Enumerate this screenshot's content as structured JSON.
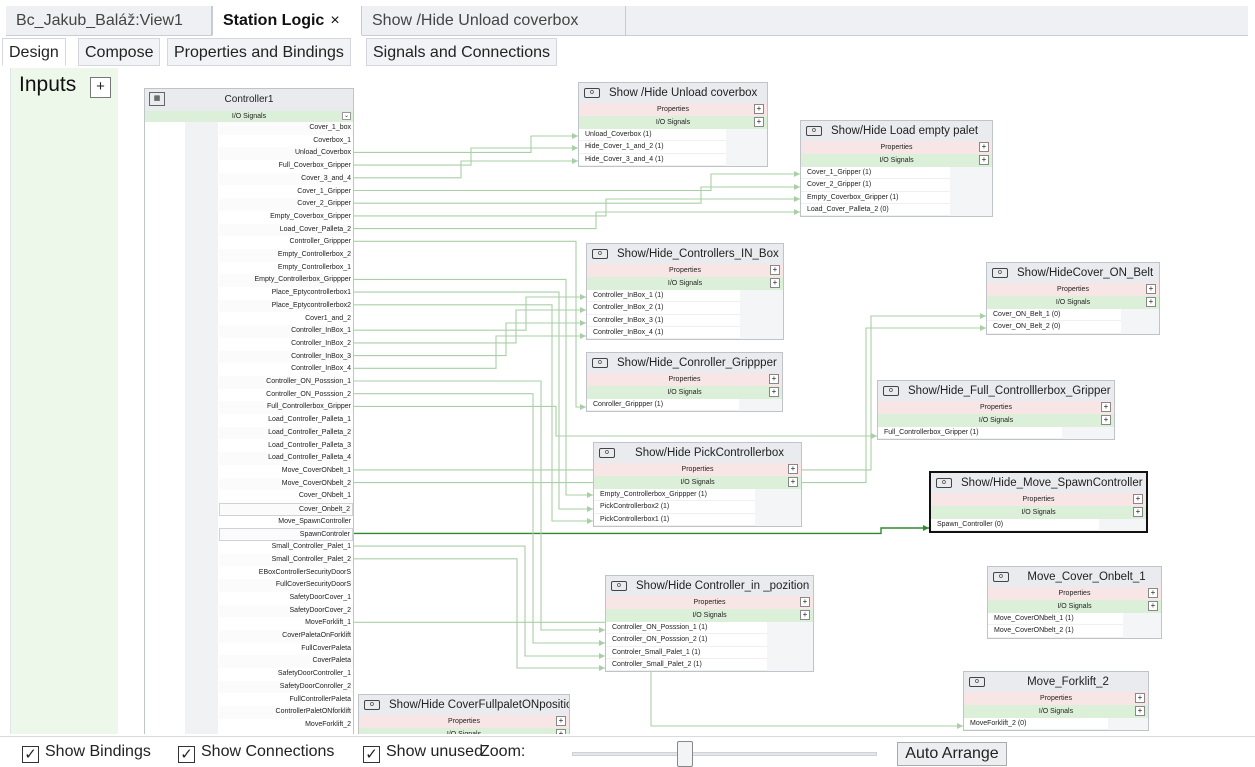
{
  "doc_tabs": [
    {
      "label": "Bc_Jakub_Baláž:View1"
    },
    {
      "label": "Station Logic",
      "close": "×"
    },
    {
      "label": "Show /Hide Unload coverbox"
    }
  ],
  "sub_tabs": [
    "Design",
    "Compose",
    "Properties and Bindings",
    "Signals and Connections"
  ],
  "inputs": {
    "title": "Inputs",
    "add": "+"
  },
  "controller": {
    "title": "Controller1",
    "io_label": "I/O Signals",
    "signals": [
      "Cover_1_box",
      "Coverbox_1",
      "Unload_Coverbox",
      "Full_Coverbox_Gripper",
      "Cover_3_and_4",
      "Cover_1_Gripper",
      "Cover_2_Gripper",
      "Empty_Coverbox_Gripper",
      "Load_Cover_Palleta_2",
      "Controller_Grippper",
      "Empty_Controllerbox_2",
      "Empty_Controllerbox_1",
      "Empty_Controllerbox_Grippper",
      "Place_Eptycontrollerbox1",
      "Place_Eptycontrollerbox2",
      "Cover1_and_2",
      "Controller_InBox_1",
      "Controller_InBox_2",
      "Controller_InBox_3",
      "Controller_InBox_4",
      "Controller_ON_Posssion_1",
      "Controller_ON_Posssion_2",
      "Full_Controllerbox_Gripper",
      "Load_Controller_Palleta_1",
      "Load_Controller_Palleta_2",
      "Load_Controller_Palleta_3",
      "Load_Controller_Palleta_4",
      "Move_CoverONbelt_1",
      "Move_CoverONbelt_2",
      "Cover_ONbelt_1",
      "Cover_Onbelt_2",
      "Move_SpawnController",
      "SpawnControler",
      "Small_Controller_Palet_1",
      "Small_Controller_Palet_2",
      "EBoxControllerSecurityDoorS",
      "FullCoverSecurityDoorS",
      "SafetyDoorCover_1",
      "SafetyDoorCover_2",
      "MoveForklift_1",
      "CoverPaletaOnForklift",
      "FullCoverPaleta",
      "CoverPaleta",
      "SafetyDoorController_1",
      "SafetyDoorConroller_2",
      "FullControllerPaleta",
      "ControllerPaletONforklift",
      "MoveForklift_2"
    ]
  },
  "components": [
    {
      "title": "Show /Hide Unload coverbox",
      "properties": "Properties",
      "io": "I/O Signals",
      "plus": "+",
      "signals": [
        "Unload_Coverbox (1)",
        "Hide_Cover_1_and_2 (1)",
        "Hide_Cover_3_and_4 (1)"
      ]
    },
    {
      "title": "Show/Hide Load empty palet",
      "properties": "Properties",
      "io": "I/O Signals",
      "plus": "+",
      "signals": [
        "Cover_1_Gripper (1)",
        "Cover_2_Gripper (1)",
        "Empty_Coverbox_Gripper (1)",
        "Load_Cover_Palleta_2 (0)"
      ]
    },
    {
      "title": "Show/Hide_Controllers_IN_Box",
      "properties": "Properties",
      "io": "I/O Signals",
      "plus": "+",
      "signals": [
        "Controller_InBox_1 (1)",
        "Controller_InBox_2 (1)",
        "Controller_InBox_3 (1)",
        "Controller_InBox_4 (1)"
      ]
    },
    {
      "title": "Show/HideCover_ON_Belt",
      "properties": "Properties",
      "io": "I/O Signals",
      "plus": "+",
      "signals": [
        "Cover_ON_Belt_1 (0)",
        "Cover_ON_Belt_2 (0)"
      ]
    },
    {
      "title": "Show/Hide_Conroller_Grippper",
      "properties": "Properties",
      "io": "I/O Signals",
      "plus": "+",
      "signals": [
        "Conroller_Grippper (1)"
      ]
    },
    {
      "title": "Show/Hide_Full_Controlllerbox_Gripper",
      "properties": "Properties",
      "io": "I/O Signals",
      "plus": "+",
      "signals": [
        "Full_Controllerbox_Gripper (1)"
      ]
    },
    {
      "title": "Show/Hide PickControllerbox",
      "properties": "Properties",
      "io": "I/O Signals",
      "plus": "+",
      "signals": [
        "Empty_Controllerbox_Grippper (1)",
        "PickControllerbox2 (1)",
        "PickControllerbox1 (1)"
      ]
    },
    {
      "title": "Show/Hide_Move_SpawnController",
      "properties": "Properties",
      "io": "I/O Signals",
      "plus": "+",
      "signals": [
        "Spawn_Controller (0)"
      ]
    },
    {
      "title": "Move_Cover_Onbelt_1",
      "properties": "Properties",
      "io": "I/O Signals",
      "plus": "+",
      "signals": [
        "Move_CoverONbelt_1 (1)",
        "Move_CoverONbelt_2 (1)"
      ]
    },
    {
      "title": "Show/Hide Controller_in _pozition",
      "properties": "Properties",
      "io": "I/O Signals",
      "plus": "+",
      "signals": [
        "Controller_ON_Posssion_1 (1)",
        "Controller_ON_Posssion_2 (1)",
        "Controler_Small_Palet_1 (1)",
        "Controller_Small_Palet_2 (1)"
      ]
    },
    {
      "title": "Move_Forklift_2",
      "properties": "Properties",
      "io": "I/O Signals",
      "plus": "+",
      "signals": [
        "MoveForklift_2 (0)"
      ]
    },
    {
      "title": "Show/Hide CoverFullpaletONposition",
      "properties": "Properties",
      "io": "I/O Signals",
      "plus": "+",
      "signals": []
    }
  ],
  "bottom": {
    "show_bindings": "Show Bindings",
    "show_connections": "Show Connections",
    "show_unused": "Show unused",
    "zoom_label": "Zoom:",
    "auto_arrange": "Auto Arrange",
    "check": "✓"
  },
  "colors": {
    "wire": "#a9cfa6",
    "wire_active": "#2f8a2f",
    "io_row": "#dcefd8",
    "prop_row": "#f8e6e6",
    "inputs_bg": "#eef8ea"
  }
}
